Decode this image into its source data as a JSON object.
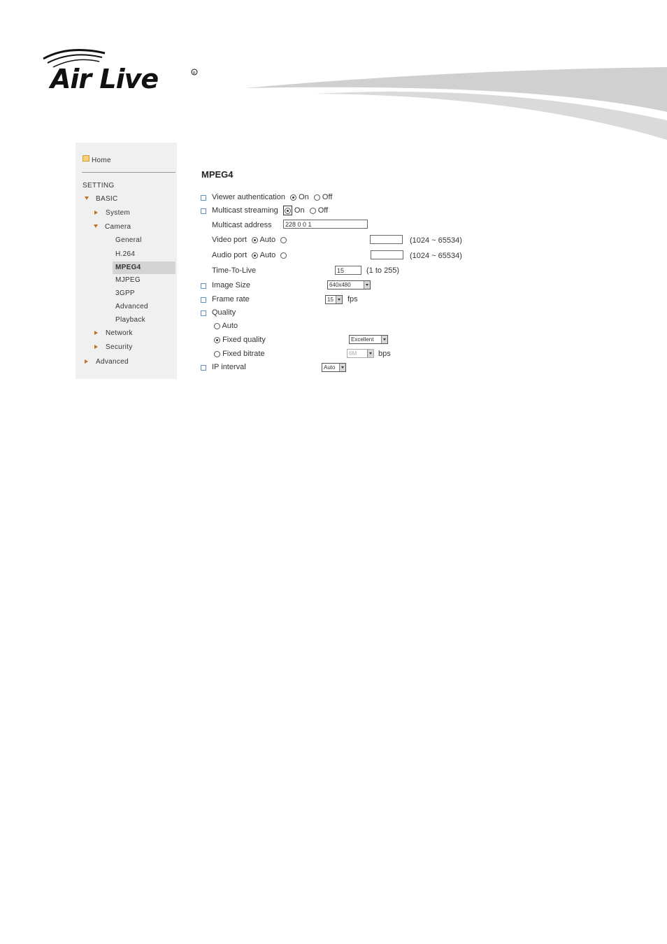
{
  "brand": {
    "logo_text": "Air Live"
  },
  "sidebar": {
    "home": "Home",
    "section": "SETTING",
    "basic": "BASIC",
    "system": "System",
    "camera": "Camera",
    "camera_items": [
      "General",
      "H.264",
      "MPEG4",
      "MJPEG",
      "3GPP",
      "Advanced",
      "Playback"
    ],
    "active_item": "MPEG4",
    "network": "Network",
    "security": "Security",
    "advanced": "Advanced"
  },
  "main": {
    "title": "MPEG4",
    "viewer_auth": {
      "label": "Viewer authentication",
      "on": "On",
      "off": "Off",
      "selected": "On"
    },
    "multicast": {
      "label": "Multicast streaming",
      "on": "On",
      "off": "Off",
      "selected": "On"
    },
    "multicast_address": {
      "label": "Multicast address",
      "value": "228 0 0 1"
    },
    "video_port": {
      "label": "Video port",
      "auto": "Auto",
      "value": "",
      "range": "(1024 ~ 65534)"
    },
    "audio_port": {
      "label": "Audio port",
      "auto": "Auto",
      "value": "",
      "range": "(1024 ~ 65534)"
    },
    "ttl": {
      "label": "Time-To-Live",
      "value": "15",
      "range": "(1 to 255)"
    },
    "image_size": {
      "label": "Image Size",
      "value": "640x480"
    },
    "frame_rate": {
      "label": "Frame rate",
      "value": "15",
      "unit": "fps"
    },
    "quality": {
      "label": "Quality",
      "auto": "Auto",
      "fixed_quality": "Fixed quality",
      "fixed_quality_value": "Excellent",
      "fixed_bitrate": "Fixed bitrate",
      "fixed_bitrate_value": "6M",
      "bitrate_unit": "bps",
      "selected": "Fixed quality"
    },
    "ip_interval": {
      "label": "IP interval",
      "value": "Auto"
    }
  },
  "colors": {
    "accent_orange": "#c07020",
    "bullet_blue": "#5a8fc8",
    "sidebar_bg": "#f0f0f0"
  }
}
